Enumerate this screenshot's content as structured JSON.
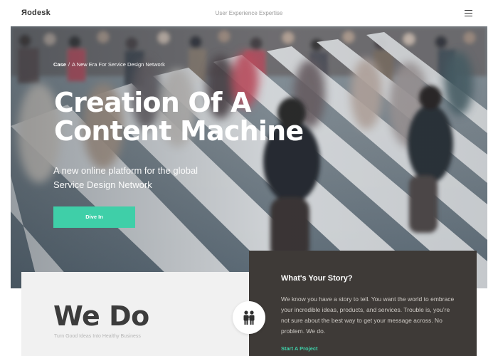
{
  "header": {
    "logo": "Яodesk",
    "tagline": "User Experience Expertise",
    "menu_icon": "hamburger-menu-icon"
  },
  "hero": {
    "breadcrumb": {
      "section": "Case",
      "separator": "/",
      "page": "A New Era For Service Design Network"
    },
    "title": "Creation Of A Content Machine",
    "subtitle": "A new online platform for the global Service Design Network",
    "cta_label": "Dive In",
    "accent_color": "#3fcfa8"
  },
  "we_do": {
    "title": "We Do",
    "subtitle": "Turn Good Ideas Into Healthy Business",
    "icon": "people-icon"
  },
  "story": {
    "title": "What's Your Story?",
    "body": "We know you have a story to tell. You want the world to embrace your incredible ideas, products, and services. Trouble is, you’re not sure about the best way to get your message across. No problem. We do.",
    "link_label": "Start A Project",
    "background_color": "#3e3a37"
  }
}
